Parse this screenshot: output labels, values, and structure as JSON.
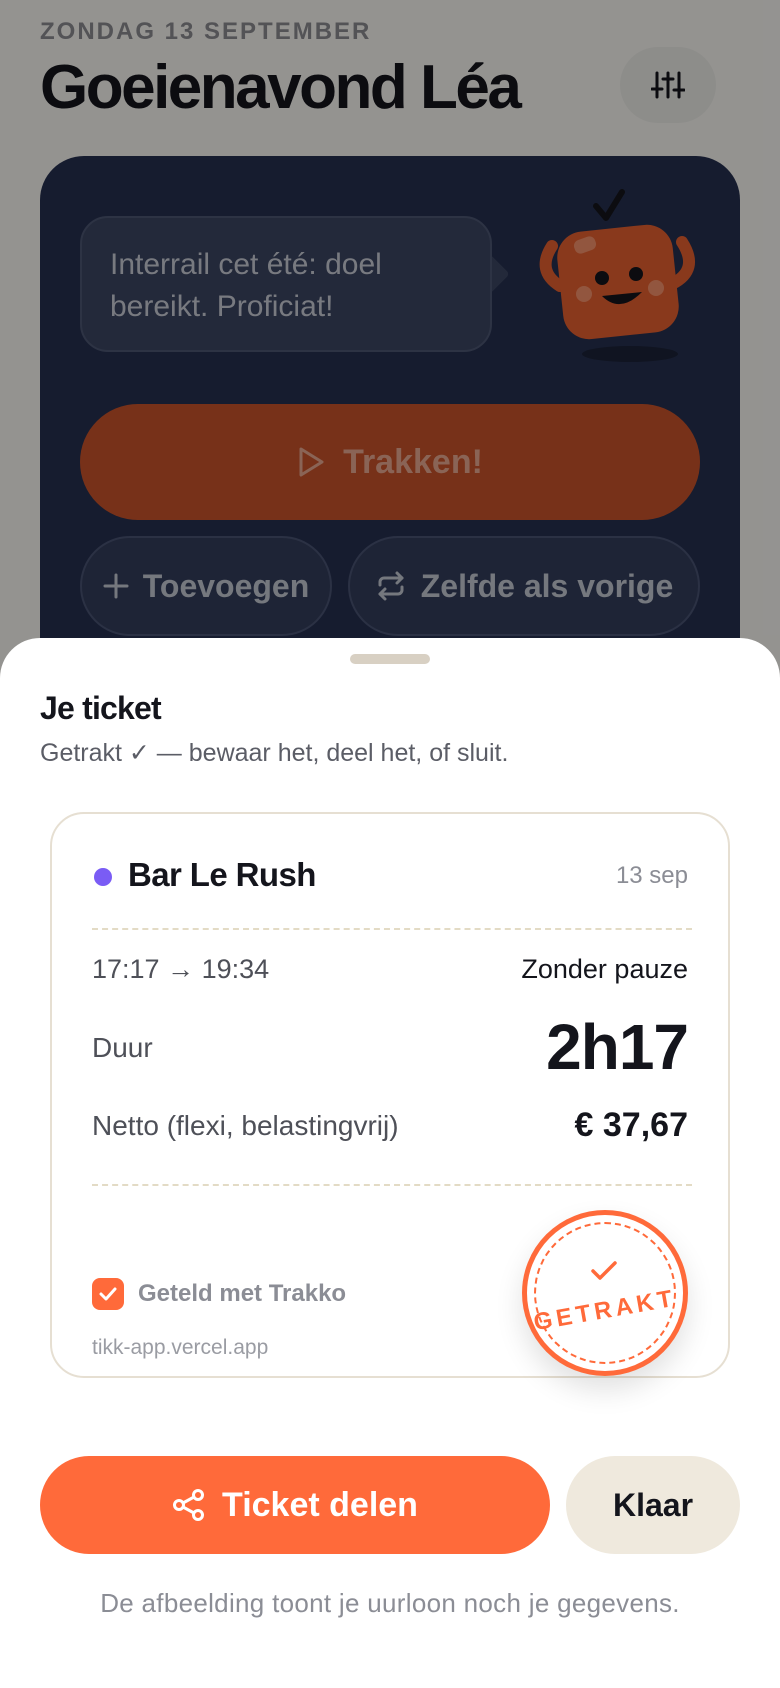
{
  "header": {
    "date": "ZONDAG 13 SEPTEMBER",
    "greeting": "Goeienavond Léa",
    "settings_icon": "sliders-icon"
  },
  "hero": {
    "message": "Interrail cet été: doel bereikt. Proficiat!",
    "track_button": "Trakken!",
    "add_button": "Toevoegen",
    "same_button": "Zelfde als vorige"
  },
  "sheet": {
    "title": "Je ticket",
    "subtitle": "Getrakt ✓ — bewaar het, deel het, of sluit.",
    "ticket": {
      "venue": "Bar Le Rush",
      "venue_color": "#7a5cf5",
      "date": "13 sep",
      "time_range": "17:17 → 19:34",
      "pause": "Zonder pauze",
      "duration_label": "Duur",
      "duration_value": "2h17",
      "net_label": "Netto (flexi, belastingvrij)",
      "net_value": "€ 37,67",
      "counted_label": "Geteld met Trakko",
      "site": "tikk-app.vercel.app",
      "stamp": "GETRAKT"
    },
    "share_button": "Ticket delen",
    "done_button": "Klaar",
    "footnote": "De afbeelding toont je uurloon noch je gegevens."
  },
  "colors": {
    "accent": "#ff6a3a",
    "hero_bg": "#26304f"
  }
}
